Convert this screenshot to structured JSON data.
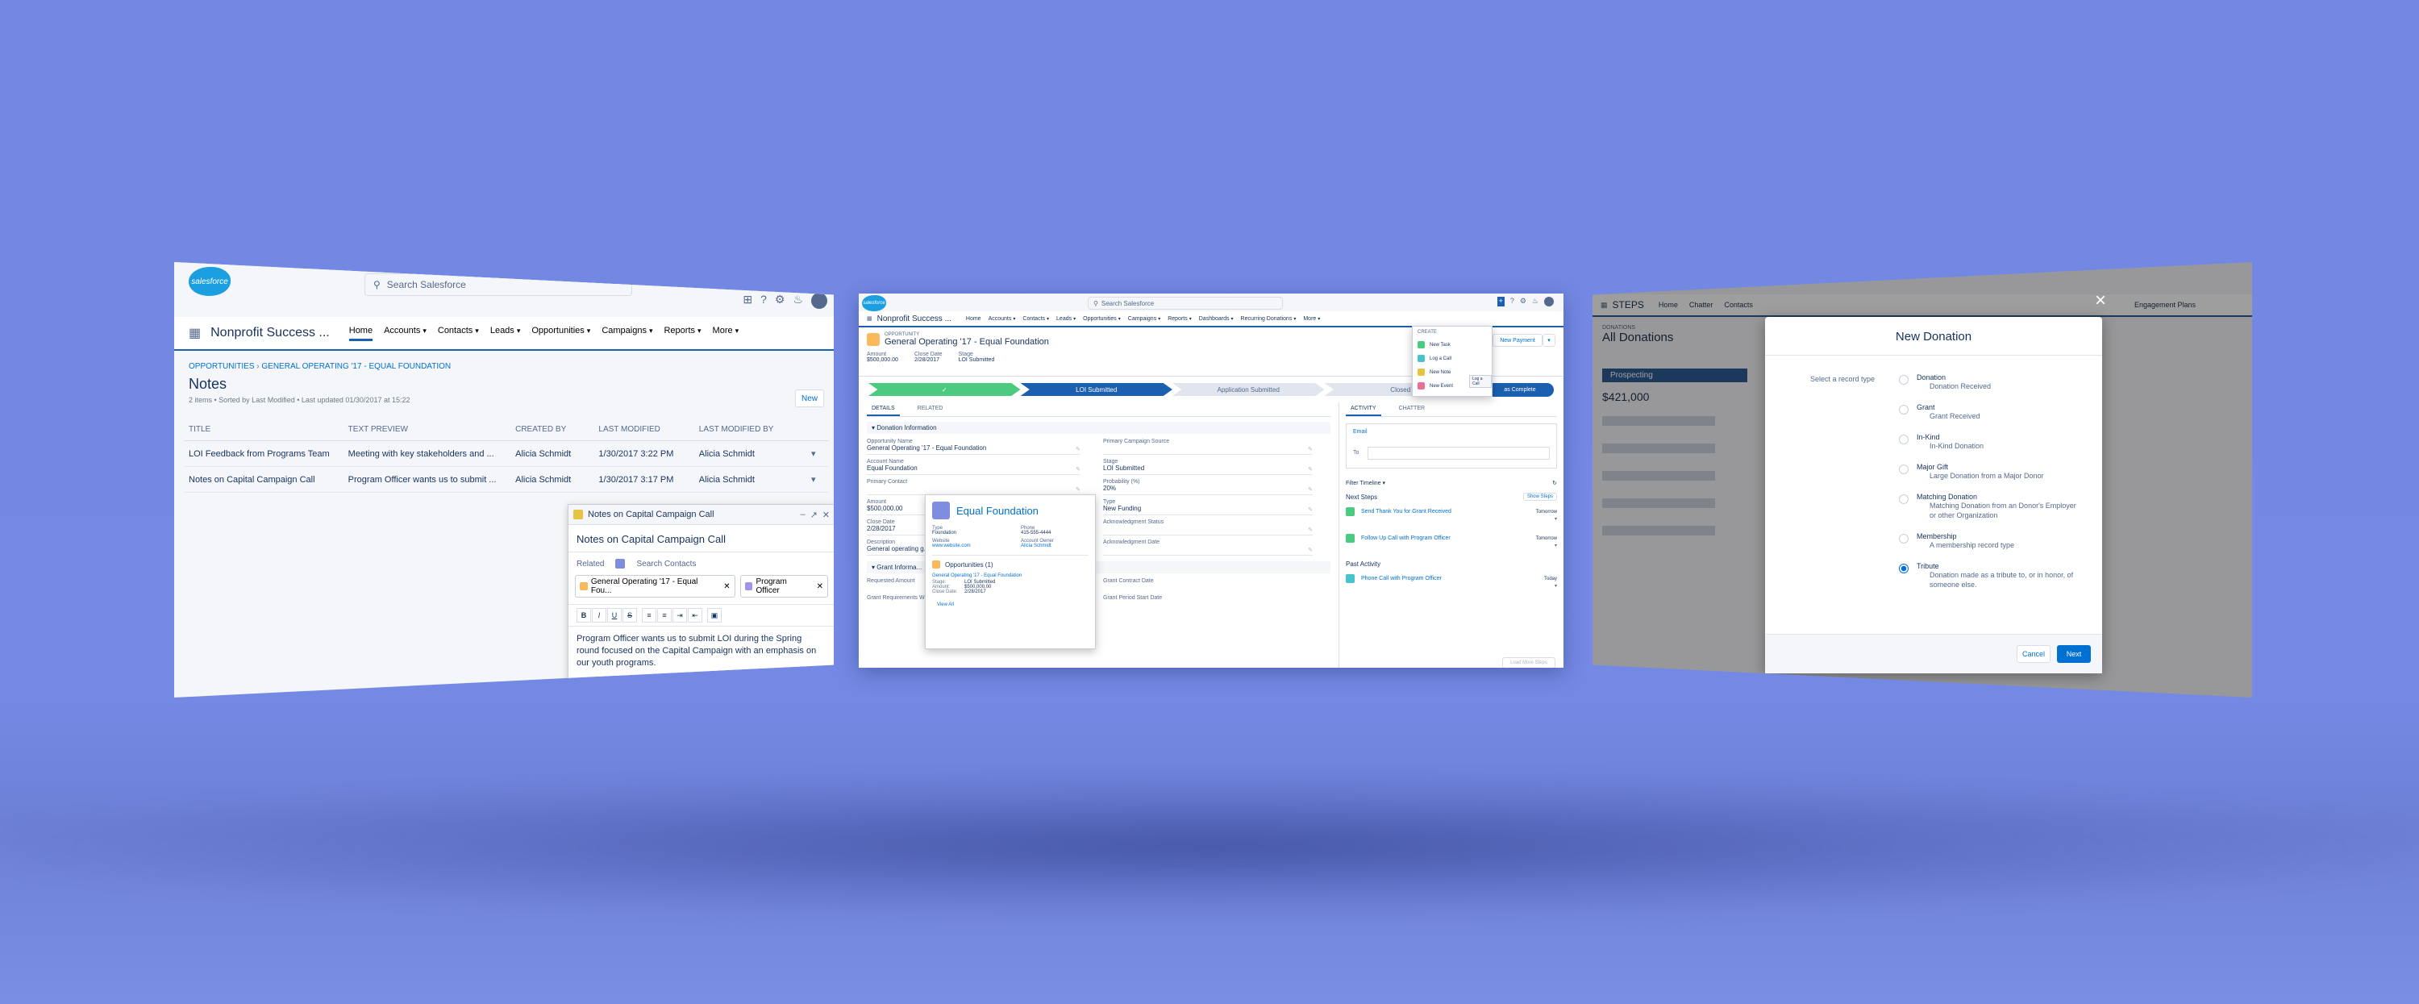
{
  "left": {
    "search_placeholder": "Search Salesforce",
    "logo_text": "salesforce",
    "app_name": "Nonprofit Success ...",
    "nav": [
      "Home",
      "Accounts",
      "Contacts",
      "Leads",
      "Opportunities",
      "Campaigns",
      "Reports",
      "More"
    ],
    "breadcrumb_1": "OPPORTUNITIES",
    "breadcrumb_2": "GENERAL OPERATING '17 - EQUAL FOUNDATION",
    "page_title": "Notes",
    "list_meta": "2 items • Sorted by Last Modified • Last updated 01/30/2017 at 15:22",
    "new_button": "New",
    "columns": [
      "TITLE",
      "TEXT PREVIEW",
      "CREATED BY",
      "LAST MODIFIED",
      "LAST MODIFIED BY"
    ],
    "rows": [
      {
        "title": "LOI Feedback from Programs Team",
        "preview": "Meeting with key stakeholders and ...",
        "created_by": "Alicia Schmidt",
        "modified": "1/30/2017 3:22 PM",
        "modified_by": "Alicia Schmidt"
      },
      {
        "title": "Notes on Capital Campaign Call",
        "preview": "Program Officer wants us to submit ...",
        "created_by": "Alicia Schmidt",
        "modified": "1/30/2017 3:17 PM",
        "modified_by": "Alicia Schmidt"
      }
    ],
    "popup": {
      "header": "Notes on Capital Campaign Call",
      "title": "Notes on Capital Campaign Call",
      "related_label": "Related",
      "search_contacts": "Search Contacts",
      "pill_1": "General Operating '17 - Equal Fou...",
      "pill_2": "Program Officer",
      "body": "Program Officer wants us to submit LOI during the Spring round focused on the Capital Campaign with an emphasis on our youth programs."
    }
  },
  "center": {
    "search_placeholder": "Search Salesforce",
    "app_name": "Nonprofit Success ...",
    "nav": [
      "Home",
      "Accounts",
      "Contacts",
      "Leads",
      "Opportunities",
      "Campaigns",
      "Reports",
      "Dashboards",
      "Recurring Donations",
      "More"
    ],
    "record_type": "OPPORTUNITY",
    "record_title": "General Operating '17 - Equal Foundation",
    "new_payment": "New Payment",
    "highlights": [
      {
        "label": "Amount",
        "value": "$500,000.00"
      },
      {
        "label": "Close Date",
        "value": "2/28/2017"
      },
      {
        "label": "Stage",
        "value": "LOI Submitted"
      }
    ],
    "path": [
      "✓",
      "LOI Submitted",
      "Application Submitted",
      "Closed"
    ],
    "mark_complete": "as Complete",
    "tabs": [
      "DETAILS",
      "RELATED"
    ],
    "section": "Donation Information",
    "left_fields": [
      {
        "label": "Opportunity Name",
        "value": "General Operating '17 - Equal Foundation"
      },
      {
        "label": "Account Name",
        "value": "Equal Foundation"
      },
      {
        "label": "Primary Contact",
        "value": ""
      },
      {
        "label": "Amount",
        "value": "$500,000.00"
      },
      {
        "label": "Close Date",
        "value": "2/28/2017"
      },
      {
        "label": "Description",
        "value": "General operating g..."
      }
    ],
    "right_fields": [
      {
        "label": "Primary Campaign Source",
        "value": ""
      },
      {
        "label": "Stage",
        "value": "LOI Submitted"
      },
      {
        "label": "Probability (%)",
        "value": "20%"
      },
      {
        "label": "Type",
        "value": "New Funding"
      },
      {
        "label": "Acknowledgment Status",
        "value": ""
      },
      {
        "label": "Acknowledgment Date",
        "value": ""
      }
    ],
    "grant_section": "Grant Informa...",
    "grant_fields": [
      "Requested Amount",
      "Grant Contract Date",
      "Grant Requirements Website",
      "Grant Period Start Date"
    ],
    "hover": {
      "title": "Equal Foundation",
      "type_label": "Type",
      "type": "Foundation",
      "phone_label": "Phone",
      "phone": "415-555-4444",
      "website_label": "Website",
      "website": "www.website.com",
      "owner_label": "Account Owner",
      "owner": "Alicia Schmidt",
      "opps": "Opportunities (1)",
      "opp_name": "General Operating '17 - Equal Foundation",
      "opp_stage": "Stage:",
      "opp_stage_v": "LOI Submitted",
      "opp_amount": "Amount:",
      "opp_amount_v": "$500,000.00",
      "opp_close": "Close Date:",
      "opp_close_v": "2/28/2017",
      "view_all": "View All"
    },
    "create_menu": {
      "header": "CREATE",
      "items": [
        "New Task",
        "Log a Call",
        "New Note",
        "New Event"
      ],
      "tooltip": "Log a Call"
    },
    "activity_tabs": [
      "ACTIVITY",
      "CHATTER"
    ],
    "email_tab": "Email",
    "to_label": "To",
    "filter": "Filter Timeline",
    "next_steps": "Next Steps",
    "show_steps": "Show Steps",
    "tasks": [
      {
        "name": "Send Thank You for Grant Received",
        "due": "Tomorrow"
      },
      {
        "name": "Follow Up Call with Program Officer",
        "due": "Tomorrow"
      }
    ],
    "past_activity": "Past Activity",
    "past": [
      {
        "name": "Phone Call with Program Officer",
        "due": "Today"
      }
    ],
    "load_more": "Load More Steps"
  },
  "right": {
    "bg_app": "STEPS",
    "bg_list_label": "DONATIONS",
    "bg_list_title": "All Donations",
    "bg_progress": "Prospecting",
    "bg_amount": "$421,000",
    "bg_nav": [
      "Home",
      "Chatter",
      "Contacts"
    ],
    "bg_nav_right": "Engagement Plans",
    "modal_title": "New Donation",
    "select_label": "Select a record type",
    "record_types": [
      {
        "name": "Donation",
        "desc": "Donation Received",
        "selected": false
      },
      {
        "name": "Grant",
        "desc": "Grant Received",
        "selected": false
      },
      {
        "name": "In-Kind",
        "desc": "In-Kind Donation",
        "selected": false
      },
      {
        "name": "Major Gift",
        "desc": "Large Donation from a Major Donor",
        "selected": false
      },
      {
        "name": "Matching Donation",
        "desc": "Matching Donation from an Donor's Employer or other Organization",
        "selected": false
      },
      {
        "name": "Membership",
        "desc": "A membership record type",
        "selected": false
      },
      {
        "name": "Tribute",
        "desc": "Donation made as a tribute to, or in honor, of someone else.",
        "selected": true
      }
    ],
    "cancel": "Cancel",
    "next": "Next",
    "close_icon": "×"
  }
}
